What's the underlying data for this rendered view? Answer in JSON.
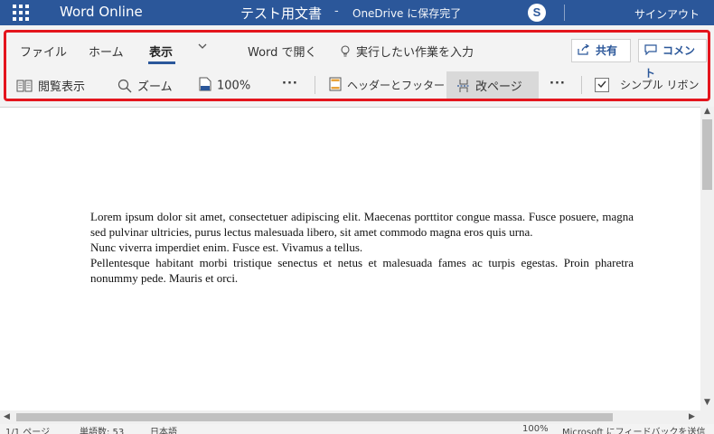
{
  "titlebar": {
    "app_name": "Word Online",
    "doc_title": "テスト用文書",
    "separator": "-",
    "save_status": "OneDrive に保存完了",
    "skype_glyph": "S",
    "signin": "サインアウト",
    "bg_color": "#2b579a"
  },
  "ribbon": {
    "tabs": [
      "ファイル",
      "ホーム",
      "表示"
    ],
    "active_tab": "表示",
    "open_in_word": "Word で開く",
    "tell_me": "実行したい作業を入力",
    "share": "共有",
    "comment": "コメント",
    "reading_view": "閲覧表示",
    "zoom": "ズーム",
    "zoom_value": "100%",
    "more": "···",
    "header_footer": "ヘッダーとフッター",
    "page_break": "改ページ",
    "more2": "···",
    "simple_ribbon": "シンプル リボン",
    "simple_ribbon_checked": true
  },
  "document": {
    "paragraphs": [
      "Lorem ipsum dolor sit amet, consectetuer adipiscing elit. Maecenas porttitor congue massa. Fusce posuere, magna sed pulvinar ultricies, purus lectus malesuada libero, sit amet commodo magna eros quis urna.",
      "Nunc viverra imperdiet enim. Fusce est. Vivamus a tellus.",
      "Pellentesque habitant morbi tristique senectus et netus et malesuada fames ac turpis egestas. Proin pharetra nonummy pede. Mauris et orci."
    ]
  },
  "statusbar": {
    "page": "1/1 ページ",
    "word_count": "単語数: 53",
    "language": "日本語",
    "zoom": "100%",
    "feedback": "Microsoft にフィードバックを送信"
  }
}
